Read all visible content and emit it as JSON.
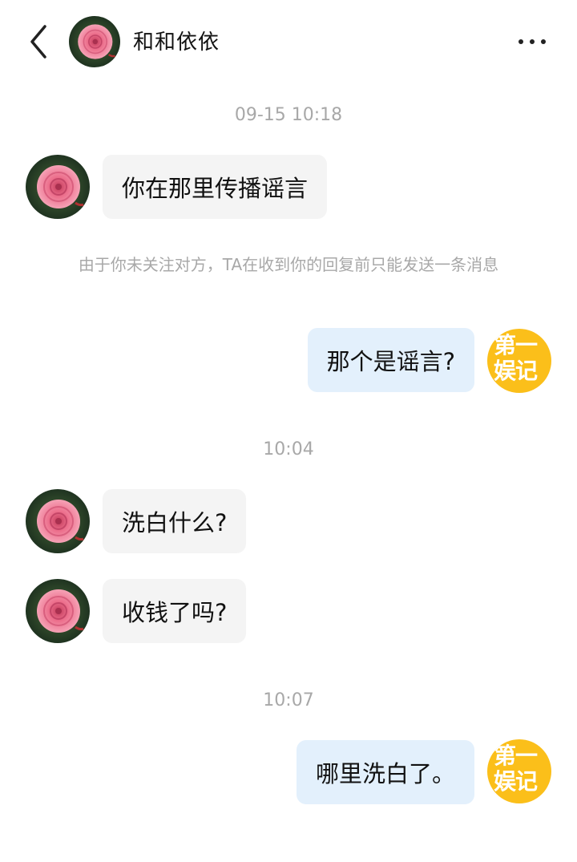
{
  "header": {
    "title": "和和依依"
  },
  "chat": {
    "timestamp_1": "09-15 10:18",
    "msg_1": "你在那里传播谣言",
    "notice": "由于你未关注对方，TA在收到你的回复前只能发送一条消息",
    "msg_2": "那个是谣言?",
    "timestamp_2": "10:04",
    "msg_3": "洗白什么?",
    "msg_4": "收钱了吗?",
    "timestamp_3": "10:07",
    "msg_5": "哪里洗白了。"
  },
  "self_badge": {
    "line1": "第一",
    "line2": "娱记"
  },
  "colors": {
    "badge": "#fbbf1a",
    "bubble_out": "#e3f0fc",
    "bubble_in": "#f4f4f4"
  },
  "icons": {
    "back": "chevron-left-icon",
    "more": "more-dots-icon",
    "avatar": "pink-rose-avatar"
  }
}
